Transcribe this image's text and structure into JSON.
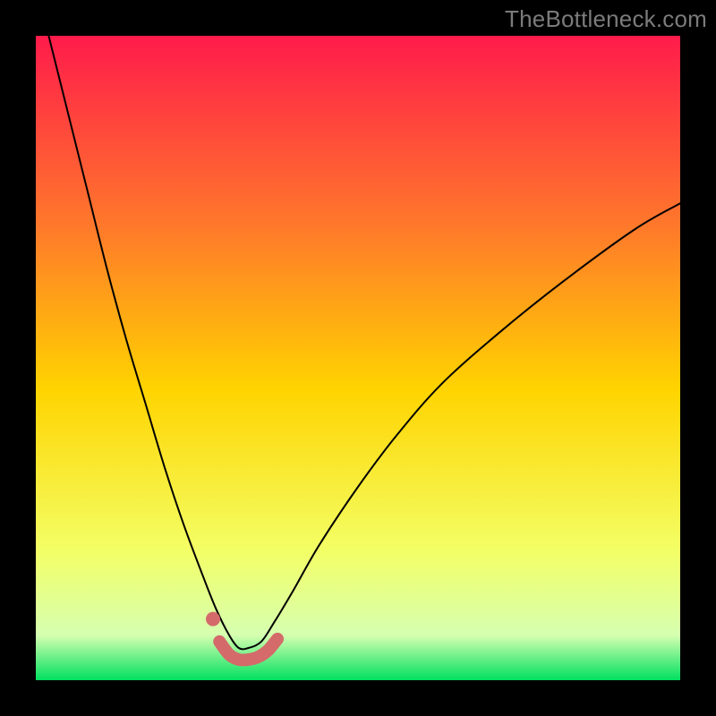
{
  "watermark": "TheBottleneck.com",
  "chart_data": {
    "type": "line",
    "title": "",
    "xlabel": "",
    "ylabel": "",
    "xlim": [
      0,
      100
    ],
    "ylim": [
      0,
      100
    ],
    "background_gradient": {
      "top": "#ff1b4b",
      "upper_mid": "#ff7a2a",
      "mid": "#ffd400",
      "lower_mid": "#f3ff66",
      "green_band_top": "#d6ffb0",
      "bottom": "#00e060"
    },
    "series": [
      {
        "name": "bottleneck-curve",
        "type": "line",
        "color": "#000000",
        "stroke_width": 2,
        "x": [
          2,
          5,
          8,
          11,
          14,
          17,
          20,
          23,
          26,
          28,
          30,
          31.5,
          33,
          35,
          37,
          40,
          44,
          50,
          56,
          63,
          72,
          82,
          93,
          100
        ],
        "values": [
          100,
          88,
          76,
          64,
          53,
          43,
          33,
          24,
          16,
          11,
          7,
          5,
          5,
          6,
          9,
          14,
          21,
          30,
          38,
          46,
          54,
          62,
          70,
          74
        ]
      },
      {
        "name": "highlight-band",
        "type": "line",
        "color": "#d46a6a",
        "stroke_width": 14,
        "x": [
          28.5,
          30,
          31.5,
          33,
          34.5,
          36,
          37.5
        ],
        "values": [
          6.0,
          4.0,
          3.2,
          3.2,
          3.6,
          4.6,
          6.4
        ]
      },
      {
        "name": "highlight-dot",
        "type": "scatter",
        "color": "#d46a6a",
        "marker_radius": 8,
        "x": [
          27.5
        ],
        "values": [
          9.5
        ]
      }
    ]
  }
}
